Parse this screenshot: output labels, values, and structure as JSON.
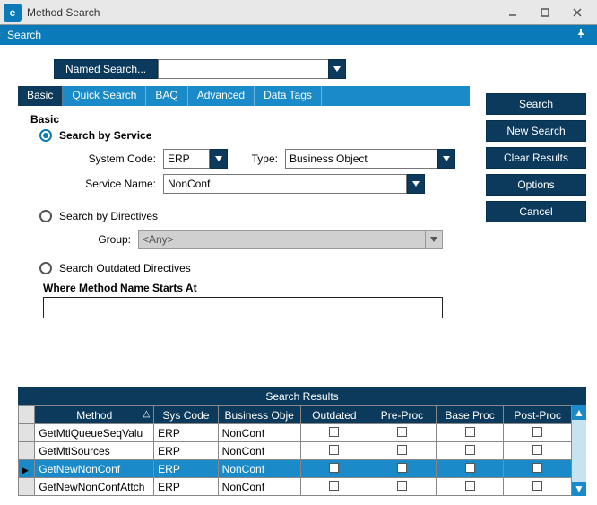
{
  "window": {
    "title": "Method Search",
    "app_icon_letter": "e"
  },
  "menubar": {
    "search": "Search"
  },
  "named_search": {
    "label": "Named Search...",
    "value": ""
  },
  "tabs": {
    "basic": "Basic",
    "quick": "Quick Search",
    "baq": "BAQ",
    "advanced": "Advanced",
    "data_tags": "Data Tags"
  },
  "basic": {
    "group_title": "Basic",
    "search_by_service": "Search by Service",
    "system_code_label": "System Code:",
    "system_code_value": "ERP",
    "type_label": "Type:",
    "type_value": "Business Object",
    "service_name_label": "Service Name:",
    "service_name_value": "NonConf",
    "search_by_directives": "Search by Directives",
    "group_label": "Group:",
    "group_value": "<Any>",
    "search_outdated": "Search Outdated Directives",
    "where_label": "Where Method Name Starts At",
    "where_value": ""
  },
  "actions": {
    "search": "Search",
    "new_search": "New Search",
    "clear_results": "Clear Results",
    "options": "Options",
    "cancel": "Cancel"
  },
  "results": {
    "title": "Search Results",
    "columns": {
      "method": "Method",
      "sys_code": "Sys Code",
      "business_obj": "Business Obje",
      "outdated": "Outdated",
      "pre_proc": "Pre-Proc",
      "base_proc": "Base Proc",
      "post_proc": "Post-Proc"
    },
    "rows": [
      {
        "method": "GetMtlQueueSeqValu",
        "sys": "ERP",
        "bo": "NonConf",
        "selected": false
      },
      {
        "method": "GetMtlSources",
        "sys": "ERP",
        "bo": "NonConf",
        "selected": false
      },
      {
        "method": "GetNewNonConf",
        "sys": "ERP",
        "bo": "NonConf",
        "selected": true
      },
      {
        "method": "GetNewNonConfAttch",
        "sys": "ERP",
        "bo": "NonConf",
        "selected": false
      }
    ]
  }
}
